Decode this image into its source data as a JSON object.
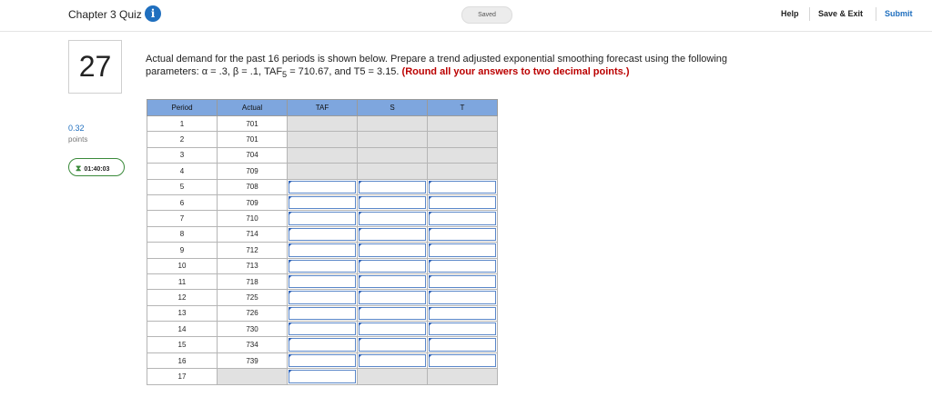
{
  "header": {
    "quiz_title": "Chapter 3 Quiz",
    "info_icon": "i",
    "saved": "Saved",
    "help": "Help",
    "save_exit": "Save & Exit",
    "submit": "Submit"
  },
  "question": {
    "number": "27",
    "points_value": "0.32",
    "points_label": "points",
    "timer": "01:40:03",
    "text_1": "Actual demand for the past 16 periods is shown below. Prepare a trend adjusted exponential smoothing forecast using the following",
    "text_2": "parameters: α = .3, β = .1, TAF",
    "text_sub": "5",
    "text_3": " = 710.67, and T5 = 3.15. ",
    "text_bold": "(Round all your answers to two decimal points.)"
  },
  "table": {
    "headers": [
      "Period",
      "Actual",
      "TAF",
      "S",
      "T"
    ],
    "rows": [
      {
        "period": "1",
        "actual": "701"
      },
      {
        "period": "2",
        "actual": "701"
      },
      {
        "period": "3",
        "actual": "704"
      },
      {
        "period": "4",
        "actual": "709"
      },
      {
        "period": "5",
        "actual": "708"
      },
      {
        "period": "6",
        "actual": "709"
      },
      {
        "period": "7",
        "actual": "710"
      },
      {
        "period": "8",
        "actual": "714"
      },
      {
        "period": "9",
        "actual": "712"
      },
      {
        "period": "10",
        "actual": "713"
      },
      {
        "period": "11",
        "actual": "718"
      },
      {
        "period": "12",
        "actual": "725"
      },
      {
        "period": "13",
        "actual": "726"
      },
      {
        "period": "14",
        "actual": "730"
      },
      {
        "period": "15",
        "actual": "734"
      },
      {
        "period": "16",
        "actual": "739"
      },
      {
        "period": "17",
        "actual": ""
      }
    ]
  },
  "colors": {
    "header_fill": "#7ea6de",
    "accent": "#1f6fbf",
    "note_red": "#bb0000",
    "timer_green": "#3a8a3a"
  }
}
